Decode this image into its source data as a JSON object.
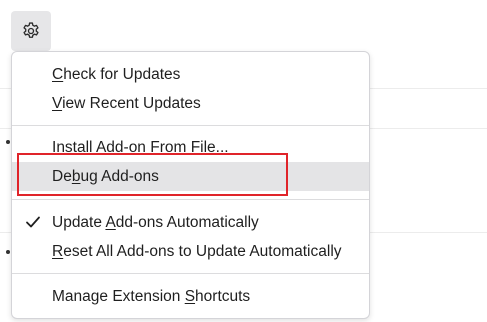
{
  "toolbar": {
    "settings_icon": "gear-icon"
  },
  "menu": {
    "items": [
      {
        "before": "",
        "key": "C",
        "after": "heck for Updates",
        "checked": false,
        "highlighted": false
      },
      {
        "before": "",
        "key": "V",
        "after": "iew Recent Updates",
        "checked": false,
        "highlighted": false
      },
      {
        "before": "",
        "key": "I",
        "after": "nstall Add-on From File...",
        "checked": false,
        "highlighted": false
      },
      {
        "before": "De",
        "key": "b",
        "after": "ug Add-ons",
        "checked": false,
        "highlighted": true
      },
      {
        "before": "Update ",
        "key": "A",
        "after": "dd-ons Automatically",
        "checked": true,
        "highlighted": false
      },
      {
        "before": "",
        "key": "R",
        "after": "eset All Add-ons to Update Automatically",
        "checked": false,
        "highlighted": false
      },
      {
        "before": "Manage Extension ",
        "key": "S",
        "after": "hortcuts",
        "checked": false,
        "highlighted": false
      }
    ]
  },
  "annotation": {
    "color": "#e0242a"
  },
  "colors": {
    "menu_hover": "#e4e4e6",
    "text": "#1f1f1f"
  }
}
